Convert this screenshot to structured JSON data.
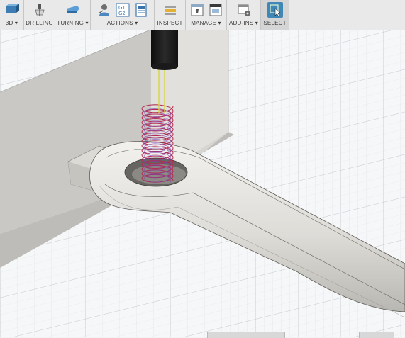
{
  "toolbar": {
    "groups": [
      {
        "label": "3D ▾",
        "icons": [
          "solid-3d-icon"
        ]
      },
      {
        "label": "DRILLING",
        "icons": [
          "drill-icon"
        ]
      },
      {
        "label": "TURNING ▾",
        "icons": [
          "turning-icon"
        ]
      },
      {
        "label": "ACTIONS ▾",
        "icons": [
          "simulate-icon",
          "gcode-icon",
          "setup-sheet-icon"
        ],
        "gcode_text": [
          "G1",
          "G2"
        ]
      },
      {
        "label": "INSPECT",
        "icons": [
          "measure-icon"
        ]
      },
      {
        "label": "MANAGE ▾",
        "icons": [
          "tool-library-icon",
          "post-library-icon"
        ]
      },
      {
        "label": "ADD-INS ▾",
        "icons": [
          "scripts-icon"
        ]
      },
      {
        "label": "SELECT",
        "icons": [
          "select-cursor-icon"
        ]
      }
    ]
  },
  "colors": {
    "toolpath": "#b42a50",
    "toolpath_secondary": "#7a3fb0",
    "tool_axis": "#d6d640",
    "select_accent": "#3f87b7",
    "grid_minor": "#d9dde0",
    "grid_major": "#c4cacf"
  }
}
